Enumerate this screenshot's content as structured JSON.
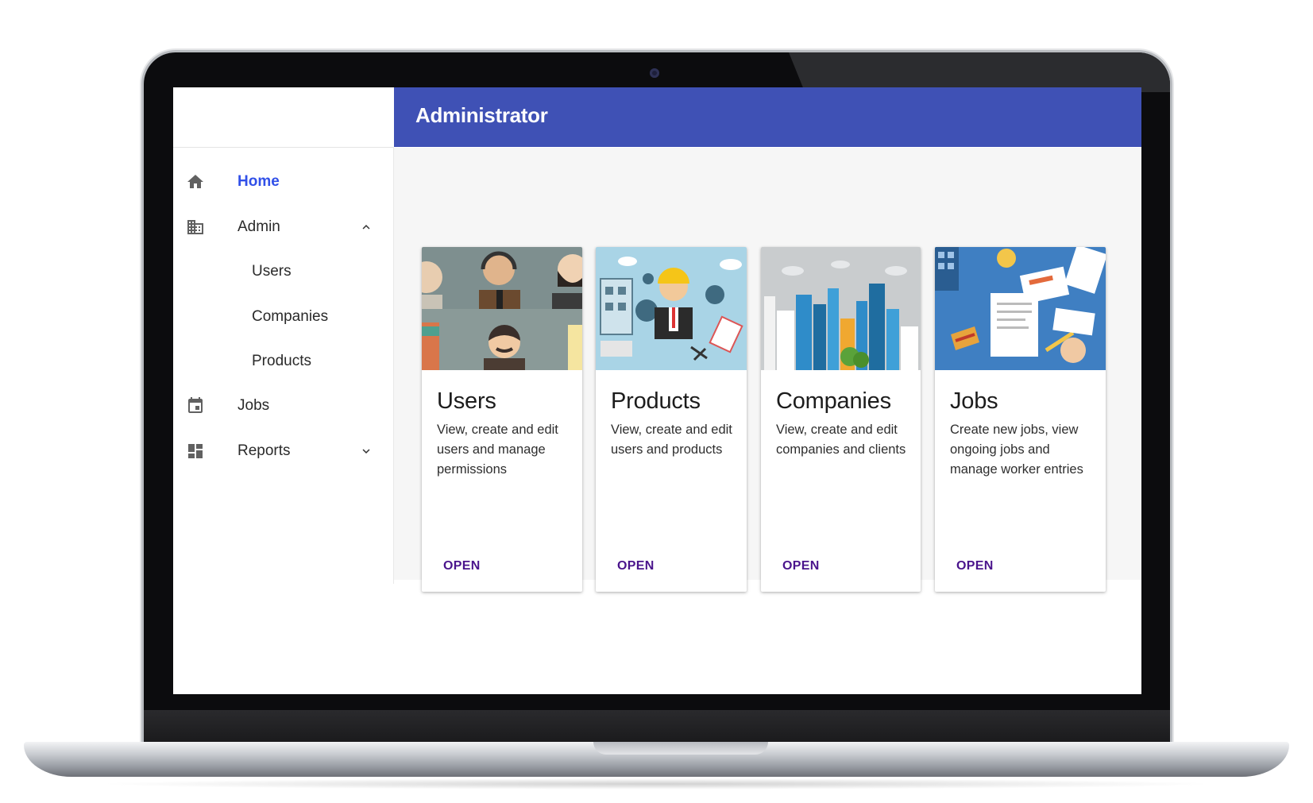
{
  "app": {
    "title": "Administrator"
  },
  "sidebar": {
    "items": [
      {
        "label": "Home",
        "icon": "home-icon",
        "active": true
      },
      {
        "label": "Admin",
        "icon": "building-icon",
        "expanded": true,
        "children": [
          {
            "label": "Users"
          },
          {
            "label": "Companies"
          },
          {
            "label": "Products"
          }
        ]
      },
      {
        "label": "Jobs",
        "icon": "calendar-icon"
      },
      {
        "label": "Reports",
        "icon": "dashboard-icon",
        "expanded": false
      }
    ]
  },
  "cards": [
    {
      "title": "Users",
      "description": "View, create and edit users and manage permissions",
      "action": "OPEN",
      "image": "people-illustration"
    },
    {
      "title": "Products",
      "description": "View, create and edit users and products",
      "action": "OPEN",
      "image": "engineer-illustration"
    },
    {
      "title": "Companies",
      "description": "View, create and edit companies and clients",
      "action": "OPEN",
      "image": "city-skyline-illustration"
    },
    {
      "title": "Jobs",
      "description": "Create new jobs, view ongoing jobs and manage worker entries",
      "action": "OPEN",
      "image": "desk-documents-illustration"
    }
  ],
  "colors": {
    "appbar": "#3f51b5",
    "active_nav": "#3150e8",
    "card_action": "#4a148c",
    "content_bg": "#f6f6f6"
  }
}
